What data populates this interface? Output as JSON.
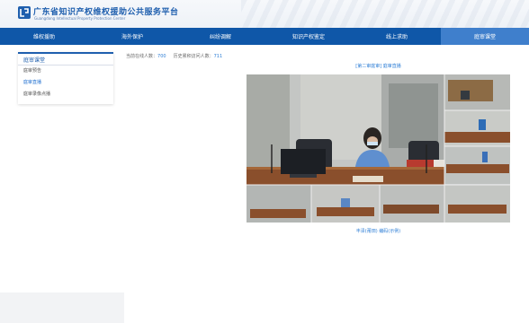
{
  "header": {
    "title": "广东省知识产权维权援助公共服务平台",
    "subtitle": "Guangdong Intellectual Property Protection Center"
  },
  "nav": {
    "items": [
      {
        "label": "维权援助",
        "active": false
      },
      {
        "label": "海外保护",
        "active": false
      },
      {
        "label": "纠纷调解",
        "active": false
      },
      {
        "label": "知识产权鉴定",
        "active": false
      },
      {
        "label": "线上求助",
        "active": false
      },
      {
        "label": "庭审课堂",
        "active": true
      }
    ]
  },
  "sidebar": {
    "title": "庭审课堂",
    "items": [
      {
        "label": "庭审预告",
        "active": false
      },
      {
        "label": "庭审直播",
        "active": true
      },
      {
        "label": "庭审录像点播",
        "active": false
      }
    ]
  },
  "stats": {
    "online_label": "当前在线人数：",
    "online_value": "700",
    "total_label": "历史累积访问人数：",
    "total_value": "711"
  },
  "video": {
    "title": "[第二审庭审] 庭审直播",
    "caption": "丰泽(莆田) 编码(示例)",
    "state": "playing"
  },
  "colors": {
    "brand_blue": "#0f57a8",
    "active_tab": "#3f7fcc",
    "link_blue": "#2f7fd6"
  }
}
